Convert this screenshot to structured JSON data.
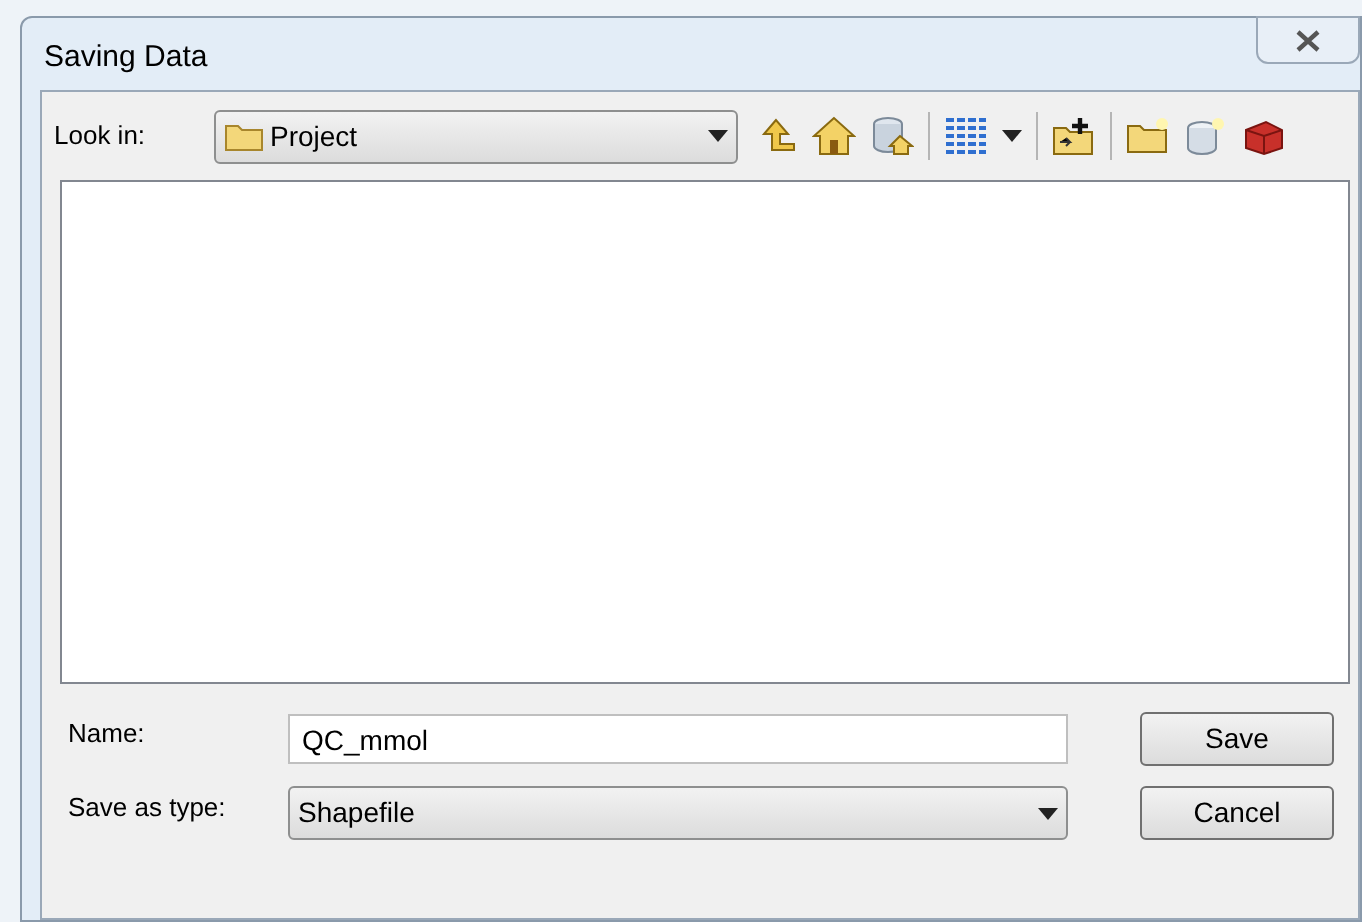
{
  "window": {
    "title": "Saving Data"
  },
  "look_in": {
    "label": "Look in:",
    "value": "Project"
  },
  "name_field": {
    "label": "Name:",
    "value": "QC_mmol"
  },
  "type_field": {
    "label": "Save as type:",
    "value": "Shapefile"
  },
  "buttons": [
    "Save",
    "Cancel"
  ]
}
